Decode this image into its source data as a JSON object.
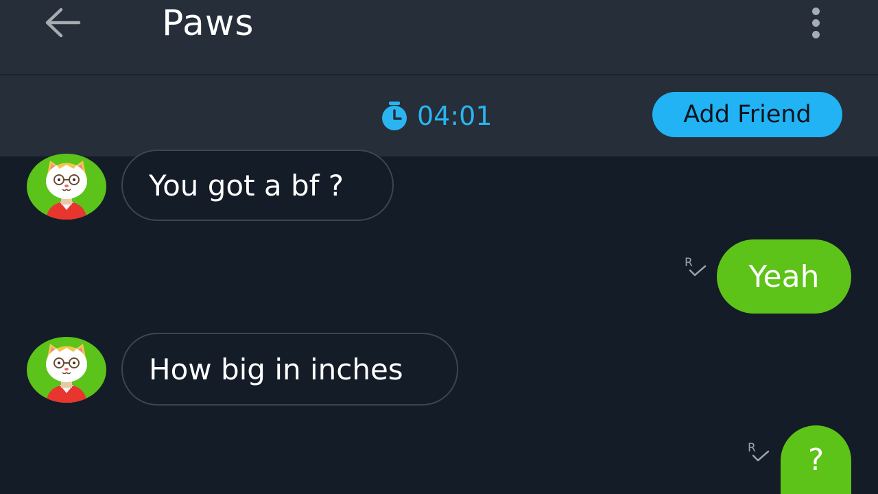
{
  "header": {
    "title": "Paws",
    "back_icon": "arrow-left-icon",
    "menu_icon": "more-vertical-icon"
  },
  "subheader": {
    "timer_icon": "stopwatch-icon",
    "timer": "04:01",
    "add_friend_label": "Add Friend"
  },
  "messages": [
    {
      "direction": "incoming",
      "text": "You got a bf ?",
      "avatar": "cat-avatar-icon"
    },
    {
      "direction": "outgoing",
      "text": "Yeah",
      "status_icon": "read-receipt-icon"
    },
    {
      "direction": "incoming",
      "text": "How big in inches",
      "avatar": "cat-avatar-icon"
    },
    {
      "direction": "outgoing",
      "text": "?",
      "status_icon": "read-receipt-icon"
    }
  ],
  "colors": {
    "header_bg": "#252e39",
    "chat_bg": "#141c27",
    "accent_blue": "#21b3f4",
    "outgoing_bubble": "#5ec318",
    "incoming_border": "#3c4653"
  }
}
